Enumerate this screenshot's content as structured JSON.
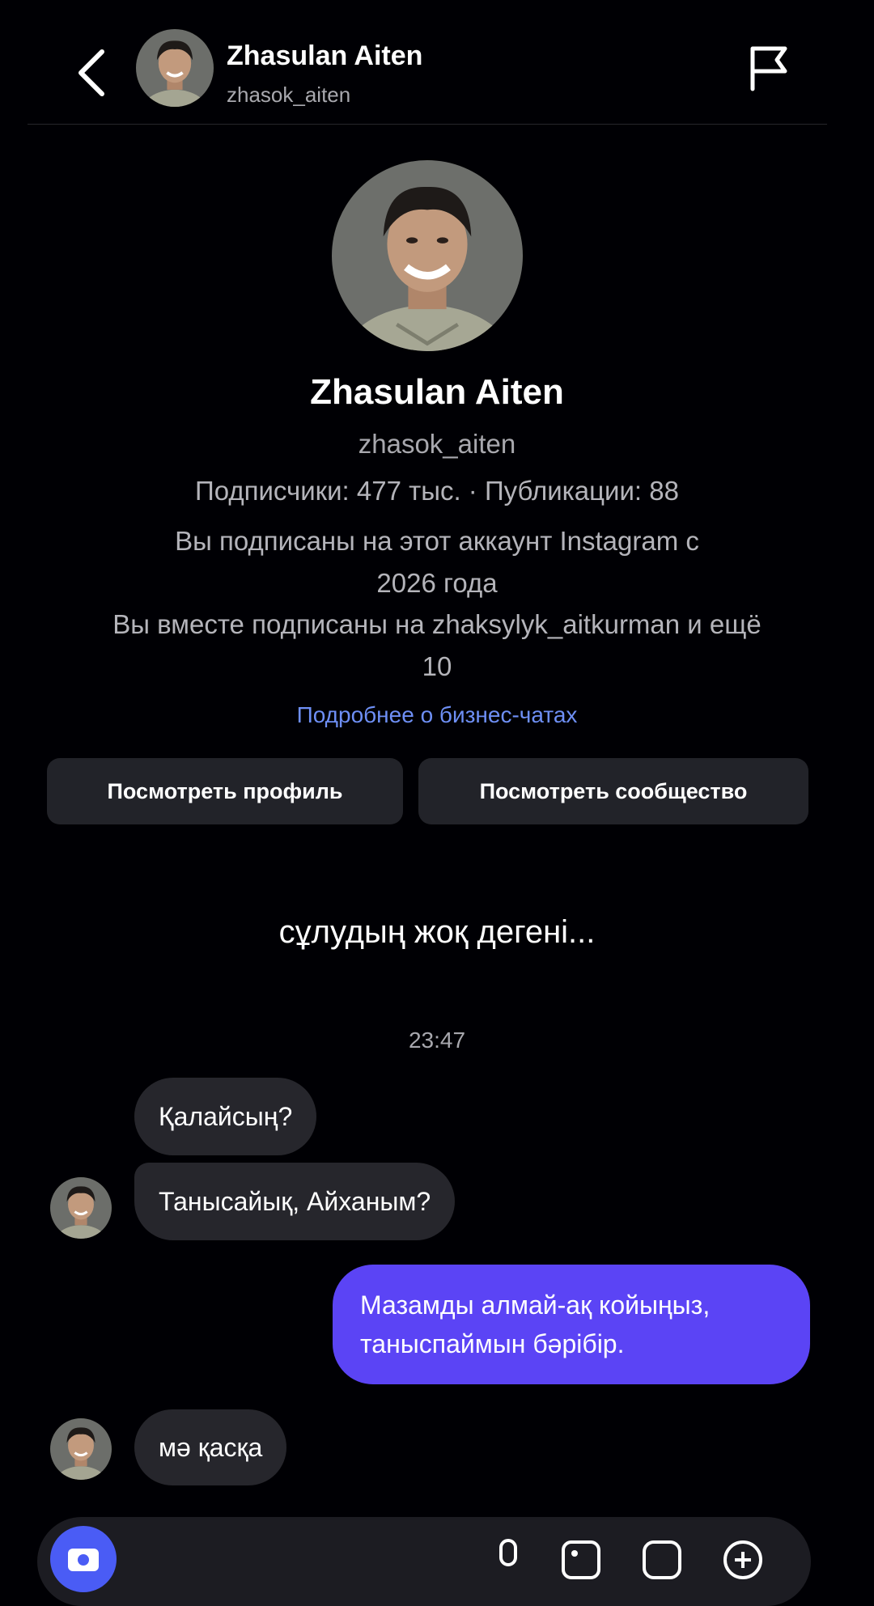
{
  "header": {
    "name": "Zhasulan Aiten",
    "username": "zhasok_aiten",
    "back_icon": "chevron-left-icon",
    "report_icon": "flag-icon"
  },
  "profile": {
    "name": "Zhasulan Aiten",
    "username": "zhasok_aiten",
    "stats": "Подписчики: 477 тыс. · Публикации: 88",
    "follow_line1": "Вы подписаны на этот аккаунт Instagram с",
    "follow_line2": "2026 года",
    "mutual_line1": "Вы вместе подписаны на zhaksylyk_aitkurman и ещё",
    "mutual_line2": "10",
    "business_link": "Подробнее о бизнес-чатах",
    "view_profile_label": "Посмотреть профиль",
    "view_community_label": "Посмотреть сообщество"
  },
  "chat": {
    "subtitle": "сұлудың жоқ дегені...",
    "timestamp": "23:47",
    "messages": [
      {
        "from": "them",
        "text": "Қалайсың?"
      },
      {
        "from": "them",
        "text": "Танысайық, Айханым?"
      },
      {
        "from": "me",
        "line1": "Мазамды алмай-ақ койыңыз,",
        "line2": "таныспаймын бәрібір."
      },
      {
        "from": "them",
        "text": "мә қасқа"
      }
    ]
  },
  "colors": {
    "background": "#000004",
    "bubble_incoming": "#26262c",
    "bubble_outgoing": "#5b44f5",
    "link": "#6e8ff5",
    "button": "#222329"
  }
}
